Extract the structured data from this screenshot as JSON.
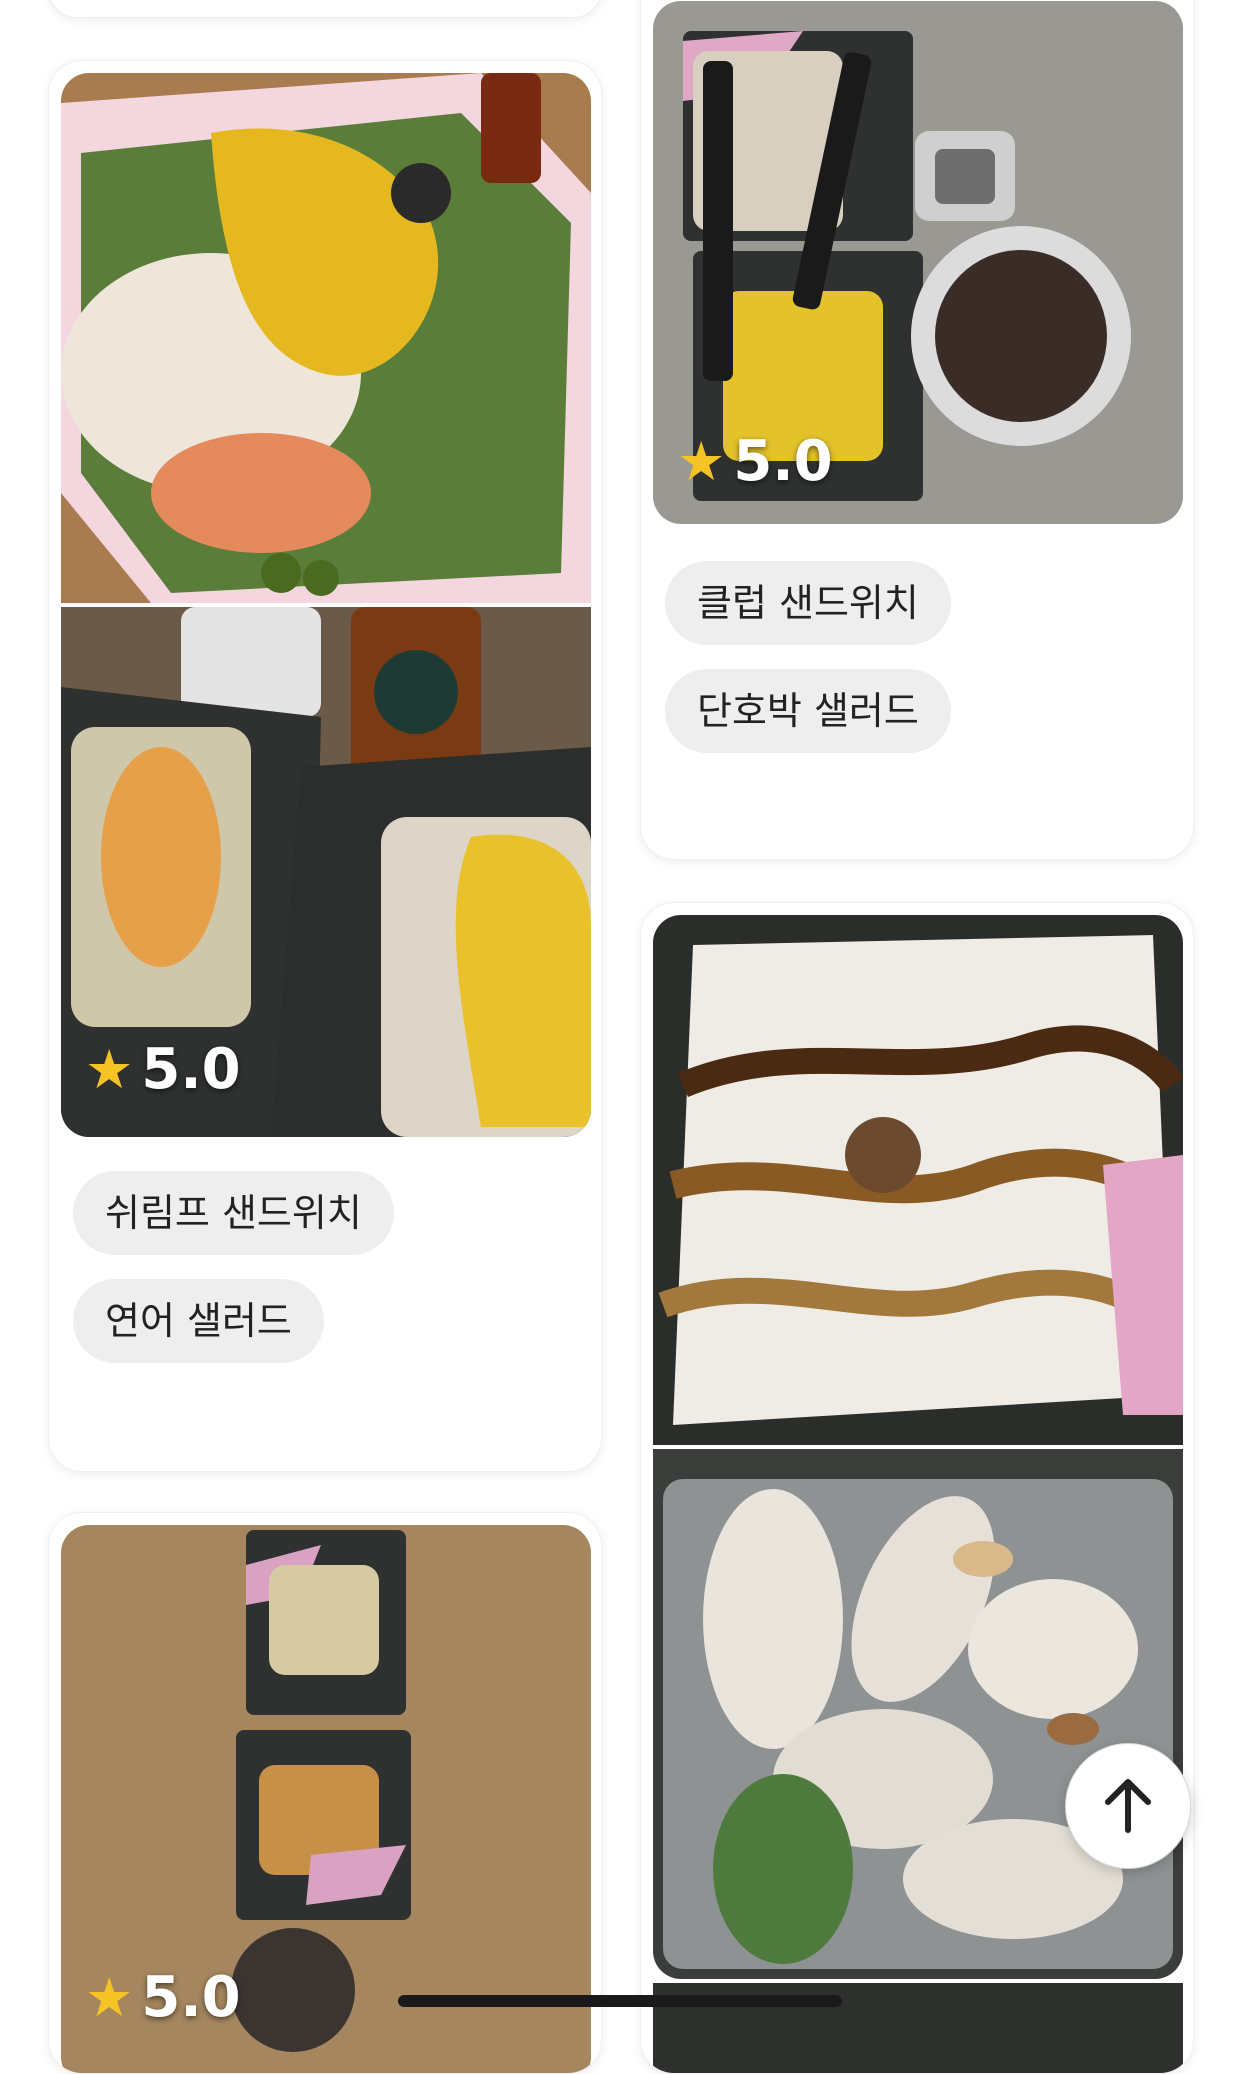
{
  "cards": [
    {
      "rating": "5.0",
      "menu_items": [
        "쉬림프 샌드위치",
        "연어 샐러드"
      ],
      "photos": [
        "salmon-salad-photo",
        "sandwich-box-photo"
      ]
    },
    {
      "rating": "5.0",
      "menu_items": [
        "클럽 샌드위치",
        "단호박 샐러드"
      ],
      "photos": [
        "club-sandwich-photo"
      ]
    },
    {
      "rating": "5.0",
      "menu_items": [],
      "photos": [
        "two-sandwich-boxes-photo"
      ]
    },
    {
      "rating": "",
      "menu_items": [],
      "photos": [
        "balsamic-cheese-salad-photo",
        "chicken-salad-photo"
      ]
    }
  ],
  "icons": {
    "star": "star-icon",
    "scroll_top": "arrow-up-icon"
  },
  "colors": {
    "star": "#f6c324",
    "chip_bg": "#eeeeee"
  }
}
